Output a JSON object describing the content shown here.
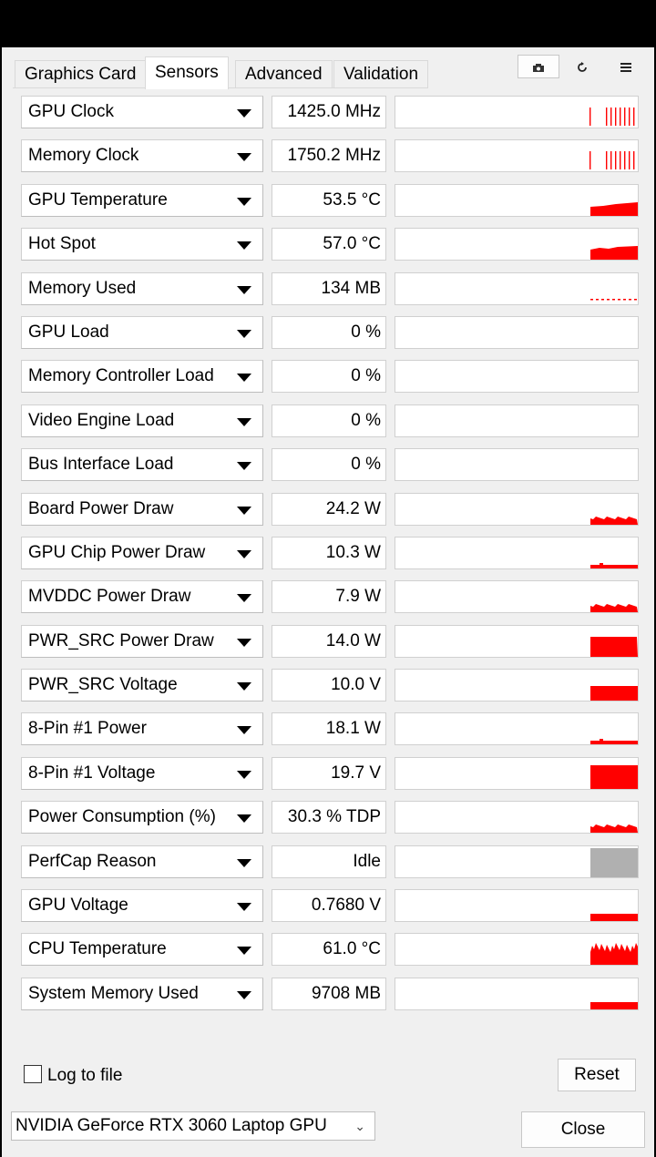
{
  "tabs": [
    {
      "label": "Graphics Card"
    },
    {
      "label": "Sensors"
    },
    {
      "label": "Advanced"
    },
    {
      "label": "Validation"
    }
  ],
  "toolbar": {
    "camera_icon": "camera-icon",
    "refresh_icon": "refresh-icon",
    "menu_icon": "menu-icon"
  },
  "graph_color": "#ff0000",
  "idle_color": "#b0b0b0",
  "sensors": [
    {
      "name": "GPU Clock",
      "value": "1425.0 MHz",
      "graph": "spikes"
    },
    {
      "name": "Memory Clock",
      "value": "1750.2 MHz",
      "graph": "spikes"
    },
    {
      "name": "GPU Temperature",
      "value": "53.5 °C",
      "graph": "ramp"
    },
    {
      "name": "Hot Spot",
      "value": "57.0 °C",
      "graph": "block"
    },
    {
      "name": "Memory Used",
      "value": "134 MB",
      "graph": "dashline"
    },
    {
      "name": "GPU Load",
      "value": "0 %",
      "graph": "none"
    },
    {
      "name": "Memory Controller Load",
      "value": "0 %",
      "graph": "none"
    },
    {
      "name": "Video Engine Load",
      "value": "0 %",
      "graph": "none"
    },
    {
      "name": "Bus Interface Load",
      "value": "0 %",
      "graph": "none"
    },
    {
      "name": "Board Power Draw",
      "value": "24.2 W",
      "graph": "low"
    },
    {
      "name": "GPU Chip Power Draw",
      "value": "10.3 W",
      "graph": "thin"
    },
    {
      "name": "MVDDC Power Draw",
      "value": "7.9 W",
      "graph": "low"
    },
    {
      "name": "PWR_SRC Power Draw",
      "value": "14.0 W",
      "graph": "high"
    },
    {
      "name": "PWR_SRC Voltage",
      "value": "10.0 V",
      "graph": "mid"
    },
    {
      "name": "8-Pin #1 Power",
      "value": "18.1 W",
      "graph": "thin"
    },
    {
      "name": "8-Pin #1 Voltage",
      "value": "19.7 V",
      "graph": "full"
    },
    {
      "name": "Power Consumption (%)",
      "value": "30.3 % TDP",
      "graph": "low"
    },
    {
      "name": "PerfCap Reason",
      "value": "Idle",
      "graph": "idle"
    },
    {
      "name": "GPU Voltage",
      "value": "0.7680 V",
      "graph": "flat"
    },
    {
      "name": "CPU Temperature",
      "value": "61.0 °C",
      "graph": "noisy"
    },
    {
      "name": "System Memory Used",
      "value": "9708 MB",
      "graph": "flat"
    }
  ],
  "log_to_file": {
    "label": "Log to file",
    "checked": false
  },
  "reset_label": "Reset",
  "gpu_select": {
    "value": "NVIDIA GeForce RTX 3060 Laptop GPU"
  },
  "close_label": "Close"
}
